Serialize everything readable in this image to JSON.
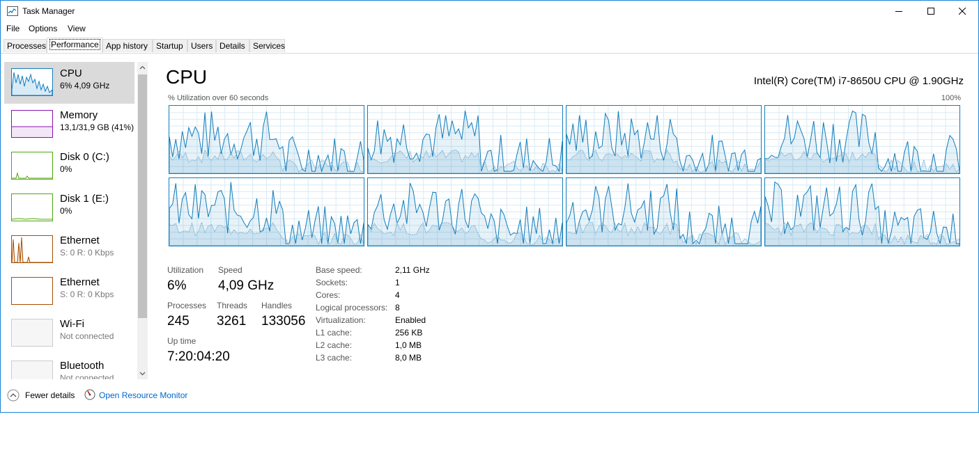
{
  "window": {
    "title": "Task Manager"
  },
  "menu": {
    "file": "File",
    "options": "Options",
    "view": "View"
  },
  "tabs": [
    "Processes",
    "Performance",
    "App history",
    "Startup",
    "Users",
    "Details",
    "Services"
  ],
  "sidebar": {
    "items": [
      {
        "name": "CPU",
        "sub": "6%  4,09 GHz",
        "color": "#117dbb"
      },
      {
        "name": "Memory",
        "sub": "13,1/31,9 GB (41%)",
        "color": "#8b12ae"
      },
      {
        "name": "Disk 0 (C:)",
        "sub": "0%",
        "color": "#4da60c"
      },
      {
        "name": "Disk 1 (E:)",
        "sub": "0%",
        "color": "#4da60c"
      },
      {
        "name": "Ethernet",
        "sub": "S: 0  R: 0 Kbps",
        "color": "#a74f01"
      },
      {
        "name": "Ethernet",
        "sub": "S: 0  R: 0 Kbps",
        "color": "#a74f01"
      },
      {
        "name": "Wi-Fi",
        "sub": "Not connected",
        "color": "#cccccc"
      },
      {
        "name": "Bluetooth",
        "sub": "Not connected",
        "color": "#cccccc"
      }
    ]
  },
  "cpu": {
    "title": "CPU",
    "model": "Intel(R) Core(TM) i7-8650U CPU @ 1.90GHz",
    "graph_label": "% Utilization over 60 seconds",
    "graph_max": "100%",
    "accent": "#117dbb"
  },
  "stats": {
    "utilization_label": "Utilization",
    "utilization": "6%",
    "speed_label": "Speed",
    "speed": "4,09 GHz",
    "processes_label": "Processes",
    "processes": "245",
    "threads_label": "Threads",
    "threads": "3261",
    "handles_label": "Handles",
    "handles": "133056",
    "uptime_label": "Up time",
    "uptime": "7:20:04:20"
  },
  "properties": [
    {
      "label": "Base speed:",
      "value": "2,11 GHz"
    },
    {
      "label": "Sockets:",
      "value": "1"
    },
    {
      "label": "Cores:",
      "value": "4"
    },
    {
      "label": "Logical processors:",
      "value": "8"
    },
    {
      "label": "Virtualization:",
      "value": "Enabled"
    },
    {
      "label": "L1 cache:",
      "value": "256 KB"
    },
    {
      "label": "L2 cache:",
      "value": "1,0 MB"
    },
    {
      "label": "L3 cache:",
      "value": "8,0 MB"
    }
  ],
  "footer": {
    "fewer_details": "Fewer details",
    "resource_monitor": "Open Resource Monitor"
  }
}
